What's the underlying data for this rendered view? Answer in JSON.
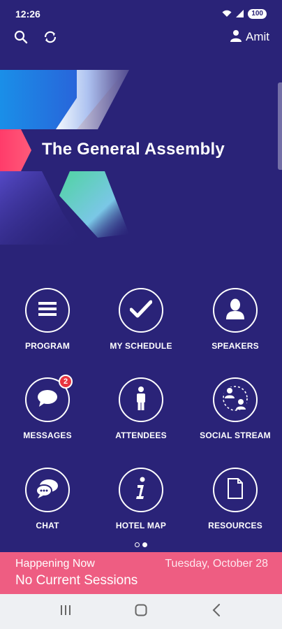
{
  "status_bar": {
    "time": "12:26",
    "battery": "100"
  },
  "toolbar": {
    "user_name": "Amit"
  },
  "banner": {
    "title": "The General Assembly"
  },
  "tiles": [
    {
      "label": "PROGRAM",
      "icon": "menu-icon"
    },
    {
      "label": "MY SCHEDULE",
      "icon": "checkmark-icon"
    },
    {
      "label": "SPEAKERS",
      "icon": "person-icon"
    },
    {
      "label": "MESSAGES",
      "icon": "chat-bubble-icon",
      "badge": "2"
    },
    {
      "label": "ATTENDEES",
      "icon": "person-info-icon"
    },
    {
      "label": "SOCIAL STREAM",
      "icon": "people-exchange-icon"
    },
    {
      "label": "CHAT",
      "icon": "chat-bubbles-icon"
    },
    {
      "label": "HOTEL MAP",
      "icon": "info-icon"
    },
    {
      "label": "RESOURCES",
      "icon": "document-icon"
    }
  ],
  "pager": {
    "pages": 2,
    "active": 2
  },
  "happening": {
    "title": "Happening Now",
    "date": "Tuesday, October 28",
    "subtitle": "No Current Sessions"
  },
  "colors": {
    "background": "#2a2378",
    "accent": "#ee5d82",
    "badge": "#e8343f"
  }
}
